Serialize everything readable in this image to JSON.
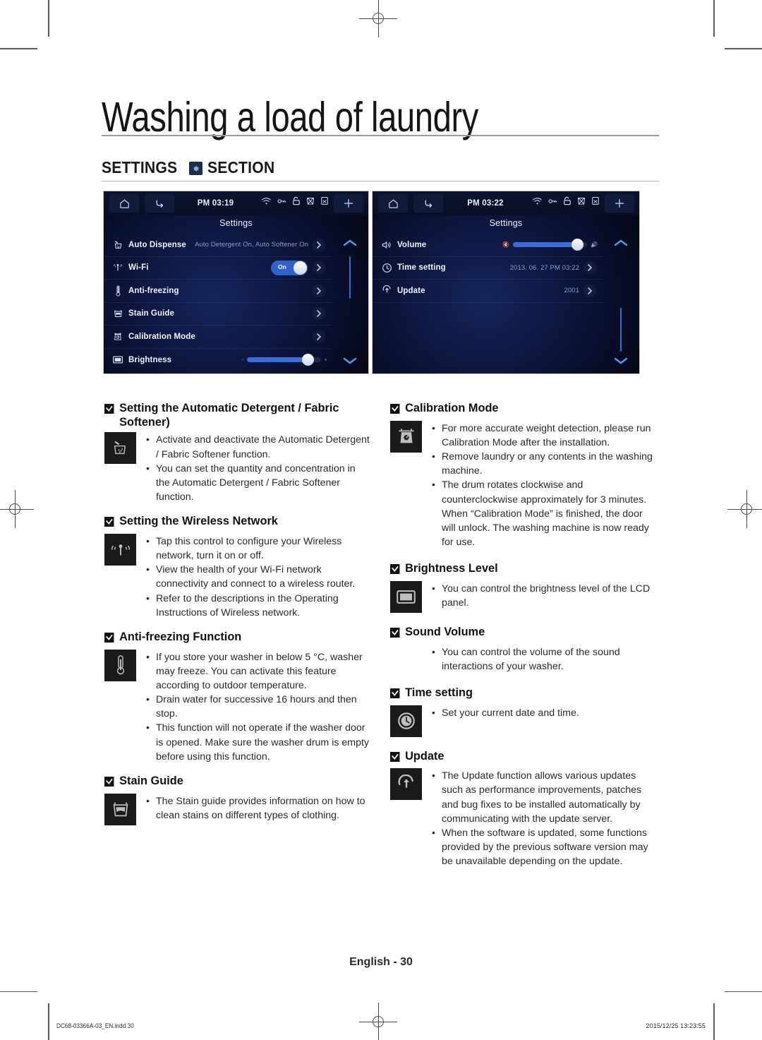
{
  "header": {
    "chapter_title": "Washing a load of laundry",
    "section_title_before": "SETTINGS",
    "section_title_after": "SECTION",
    "section_icon": "gear-icon"
  },
  "lcd_screens": [
    {
      "name": "settings-screen-page-1",
      "topbar": {
        "home_icon": "home-icon",
        "back_icon": "back-arrow-icon",
        "time": "PM 03:19",
        "status_icons": [
          "wifi-icon",
          "key-icon",
          "lock-open-icon",
          "no-wash-icon",
          "no-tumble-dry-icon"
        ],
        "plus_icon": "plus-icon"
      },
      "title": "Settings",
      "rows": [
        {
          "icon": "auto-dispense-icon",
          "label": "Auto Dispense",
          "value": "Auto Detergent On, Auto Softener On",
          "control": "chevron"
        },
        {
          "icon": "wifi-icon",
          "label": "Wi-Fi",
          "value": "",
          "control": "toggle",
          "toggle_label": "On",
          "toggle_state": "on"
        },
        {
          "icon": "thermometer-icon",
          "label": "Anti-freezing",
          "value": "",
          "control": "chevron"
        },
        {
          "icon": "stain-guide-icon",
          "label": "Stain Guide",
          "value": "",
          "control": "chevron"
        },
        {
          "icon": "scale-icon",
          "label": "Calibration Mode",
          "value": "",
          "control": "chevron"
        },
        {
          "icon": "brightness-icon",
          "label": "Brightness",
          "value": "",
          "control": "slider",
          "slider_percent": 82
        }
      ],
      "scroll_up_icon": "chevron-up-icon",
      "scroll_down_icon": "chevron-down-icon"
    },
    {
      "name": "settings-screen-page-2",
      "topbar": {
        "home_icon": "home-icon",
        "back_icon": "back-arrow-icon",
        "time": "PM 03:22",
        "status_icons": [
          "wifi-icon",
          "key-icon",
          "lock-open-icon",
          "no-wash-icon",
          "no-tumble-dry-icon"
        ],
        "plus_icon": "plus-icon"
      },
      "title": "Settings",
      "rows": [
        {
          "icon": "speaker-icon",
          "label": "Volume",
          "value": "",
          "control": "slider",
          "slider_percent": 87
        },
        {
          "icon": "clock-icon",
          "label": "Time setting",
          "value": "2013. 06. 27 PM 03:22",
          "control": "chevron"
        },
        {
          "icon": "update-icon",
          "label": "Update",
          "value": "2001",
          "control": "chevron"
        }
      ],
      "scroll_up_icon": "chevron-up-icon",
      "scroll_down_icon": "chevron-down-icon"
    }
  ],
  "left_column": [
    {
      "heading": "Setting the Automatic Detergent / Fabric Softener)",
      "icon": "detergent-dispense-icon",
      "bullets": [
        "Activate and deactivate the Automatic Detergent / Fabric Softener function.",
        "You can set the quantity and concentration in the Automatic Detergent / Fabric Softener function."
      ]
    },
    {
      "heading": "Setting the Wireless Network",
      "icon": "wireless-network-icon",
      "bullets": [
        "Tap this control to configure your Wireless network, turn it on or off.",
        "View the health of your Wi-Fi network connectivity and connect to a wireless router.",
        "Refer to the descriptions in the Operating Instructions of Wireless network."
      ]
    },
    {
      "heading": "Anti-freezing Function",
      "icon": "thermometer-icon",
      "bullets": [
        "If you store your washer in below 5 °C, washer may freeze. You can activate this feature according to outdoor temperature.",
        "Drain water for successive 16 hours and then stop.",
        "This function will not operate if the washer door is opened. Make sure the washer drum is empty before using this function."
      ]
    },
    {
      "heading": "Stain Guide",
      "icon": "stain-guide-icon",
      "bullets": [
        "The Stain guide provides information on how to clean stains on different types of clothing."
      ]
    }
  ],
  "right_column": [
    {
      "heading": "Calibration Mode",
      "icon": "scale-icon",
      "bullets": [
        "For more accurate weight detection, please run Calibration Mode after the installation.",
        "Remove laundry or any contents in the washing machine.",
        "The drum rotates clockwise and counterclockwise approximately for 3 minutes. When “Calibration Mode” is finished, the door will unlock. The washing machine is now ready for use."
      ]
    },
    {
      "heading": "Brightness Level",
      "icon": "brightness-icon",
      "bullets": [
        "You can control the brightness level of the LCD panel."
      ]
    },
    {
      "heading": "Sound Volume",
      "icon": "",
      "bullets": [
        "You can control the volume of the sound interactions of your washer."
      ]
    },
    {
      "heading": "Time setting",
      "icon": "clock-icon",
      "bullets": [
        "Set your current date and time."
      ]
    },
    {
      "heading": "Update",
      "icon": "update-icon",
      "bullets": [
        "The Update function allows various updates such as performance improvements, patches and bug fixes to be installed automatically by communicating with the update server.",
        "When the software is updated, some functions provided by the previous software version may be unavailable depending on the update."
      ]
    }
  ],
  "footer": {
    "page_label": "English - 30",
    "file_name": "DC68-03366A-03_EN.indd   30",
    "timestamp": "2015/12/25   13:23:55"
  },
  "colors": {
    "lcd_accent": "#3a6ddc",
    "toggle_on": "#2e62cf",
    "icon_box": "#1a1a1a",
    "text": "#2b2b2b"
  }
}
